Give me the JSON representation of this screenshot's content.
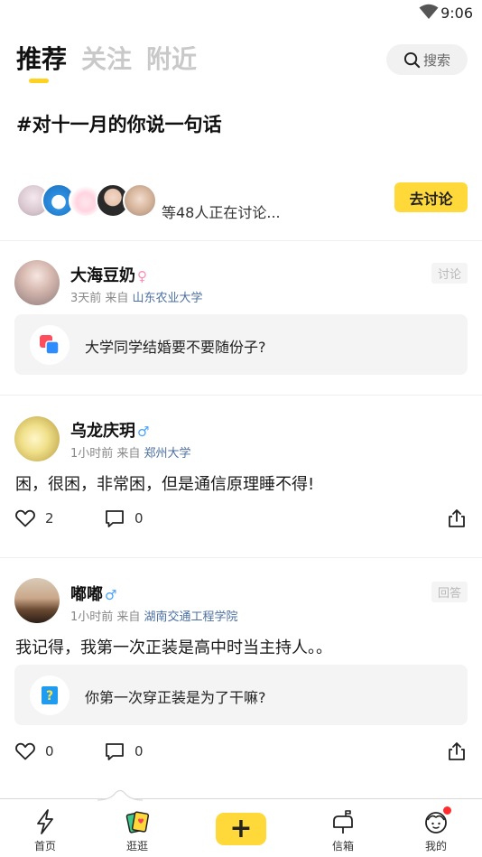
{
  "status_bar": {
    "time": "9:06"
  },
  "header": {
    "tabs": [
      {
        "label": "推荐",
        "active": true
      },
      {
        "label": "关注",
        "active": false
      },
      {
        "label": "附近",
        "active": false
      }
    ],
    "search_label": "搜索"
  },
  "topic": {
    "title": "#对十一月的你说一句话",
    "participants_text": "等48人正在讨论...",
    "join_button": "去讨论"
  },
  "posts": [
    {
      "name": "大海豆奶",
      "gender": "♀",
      "time": "3天前 来自",
      "school": "山东农业大学",
      "tag": "讨论",
      "question": "大学同学结婚要不要随份子?"
    },
    {
      "name": "乌龙庆玥",
      "gender": "♂",
      "time": "1小时前 来自",
      "school": "郑州大学",
      "content": "困，很困，非常困，但是通信原理睡不得!",
      "likes": "2",
      "comments": "0"
    },
    {
      "name": "嘟嘟",
      "gender": "♂",
      "time": "1小时前 来自",
      "school": "湖南交通工程学院",
      "tag": "回答",
      "content": "我记得，我第一次正装是高中时当主持人。。",
      "question": "你第一次穿正装是为了干嘛?",
      "likes": "0",
      "comments": "0"
    }
  ],
  "bottom_nav": {
    "items": [
      {
        "label": "首页"
      },
      {
        "label": "逛逛"
      },
      {
        "label": "信箱"
      },
      {
        "label": "我的"
      }
    ],
    "add_symbol": "+"
  },
  "colors": {
    "accent": "#ffd83a",
    "school_link": "#4b6fa0",
    "badge": "#ff2d2d"
  }
}
